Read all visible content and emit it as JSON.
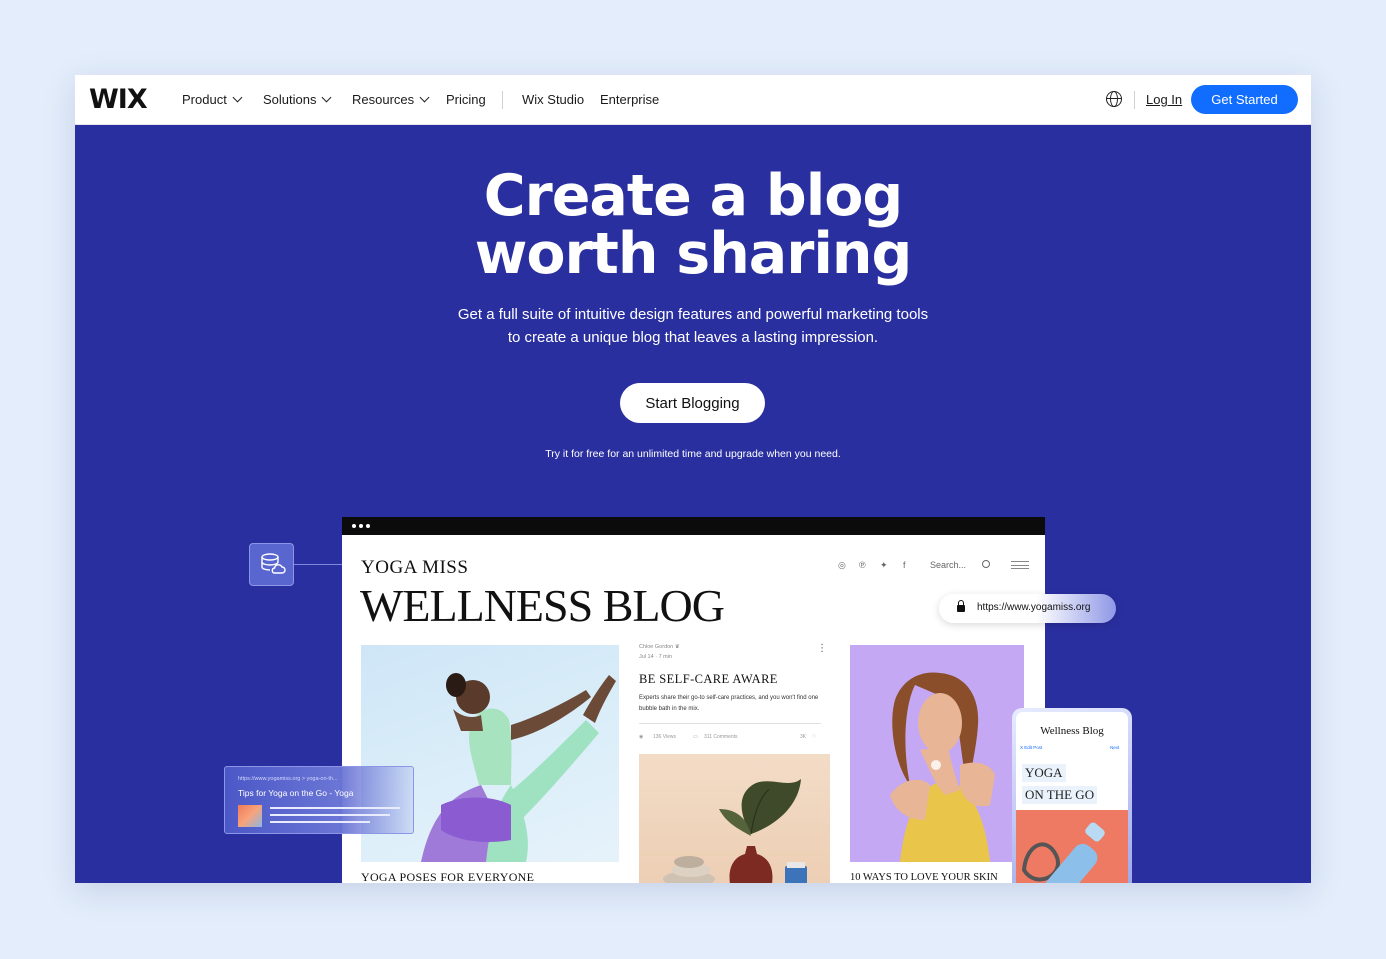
{
  "nav": {
    "logo": "WIX",
    "items": [
      {
        "label": "Product",
        "dropdown": true
      },
      {
        "label": "Solutions",
        "dropdown": true
      },
      {
        "label": "Resources",
        "dropdown": true
      },
      {
        "label": "Pricing",
        "dropdown": false
      },
      {
        "label": "Wix Studio",
        "dropdown": false
      },
      {
        "label": "Enterprise",
        "dropdown": false
      }
    ],
    "login_label": "Log In",
    "cta_label": "Get Started",
    "language_icon": "globe-icon"
  },
  "hero": {
    "title_line1": "Create a blog",
    "title_line2": "worth sharing",
    "subtitle_line1": "Get a full suite of intuitive design features and powerful marketing tools",
    "subtitle_line2": "to create a unique blog that leaves a lasting impression.",
    "cta_label": "Start Blogging",
    "note": "Try it for free for an unlimited time and upgrade when you need."
  },
  "mock_blog": {
    "brand_small": "YOGA MISS",
    "brand_large": "WELLNESS BLOG",
    "search_label": "Search...",
    "url": "https://www.yogamiss.org",
    "card1_caption": "YOGA POSES FOR EVERYONE",
    "post": {
      "author": "Chloe Gordon ♛",
      "date": "Jul 14 · 7 min",
      "title": "BE SELF-CARE AWARE",
      "excerpt": "Experts share their go-to self-care practices, and you won't find one bubble bath in the mix.",
      "views": "136 Views",
      "comments": "311 Comments",
      "likes": "3K"
    },
    "card3_caption": "10 WAYS TO LOVE YOUR SKIN"
  },
  "snippet": {
    "url": "https://www.yogamiss.org > yoga-on-th...",
    "title": "Tips for Yoga on the Go - Yoga"
  },
  "phone": {
    "title": "Wellness Blog",
    "edit_label": "X  Edit Post",
    "next_label": "Next",
    "tag1": "YOGA",
    "tag2": "ON THE GO"
  },
  "colors": {
    "hero_bg": "#2a2fa0",
    "cta_blue": "#116dff",
    "page_bg": "#e3edfb"
  }
}
